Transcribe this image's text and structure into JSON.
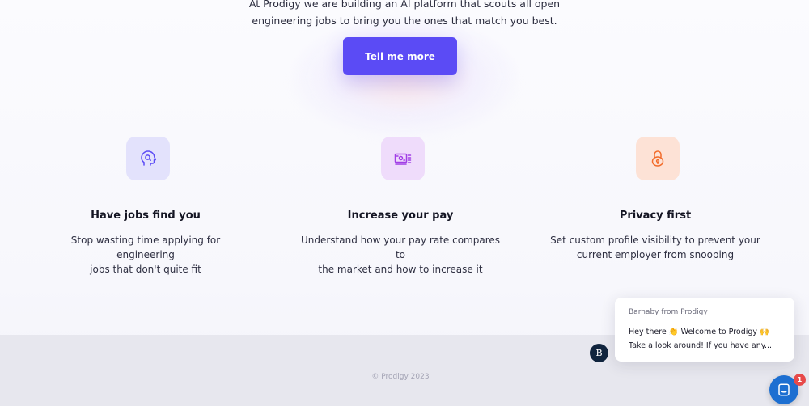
{
  "hero": {
    "intro_line1": "At Prodigy we are building an AI platform that scouts all open",
    "intro_line2": "engineering jobs to bring you the ones that match you best.",
    "cta_label": "Tell me more"
  },
  "features": [
    {
      "icon": "head-search-icon",
      "title": "Have jobs find you",
      "desc_line1": "Stop wasting time applying for engineering",
      "desc_line2": "jobs that don't quite fit",
      "tile_color": "#e3e2fc",
      "icon_color": "#5b4bf5"
    },
    {
      "icon": "money-icon",
      "title": "Increase your pay",
      "desc_line1": "Understand how your pay rate compares to",
      "desc_line2": "the market and how to increase it",
      "tile_color": "#efdcfb",
      "icon_color": "#a13ee6"
    },
    {
      "icon": "lock-icon",
      "title": "Privacy first",
      "desc_line1": "Set custom profile visibility to prevent your",
      "desc_line2": "current employer from snooping",
      "tile_color": "#fde2d6",
      "icon_color": "#f26b2a"
    }
  ],
  "footer": {
    "copyright": "© Prodigy 2023"
  },
  "chat": {
    "sender": "Barnaby from Prodigy",
    "message_line1": "Hey there 👏 Welcome to Prodigy 🙌",
    "message_line2": "Take a look around! If you have any...",
    "avatar_initial": "B",
    "unread_count": "1",
    "accent_color": "#1d6fd1"
  },
  "colors": {
    "primary": "#5b4bf5",
    "footer_bg": "#e7e7ee"
  }
}
